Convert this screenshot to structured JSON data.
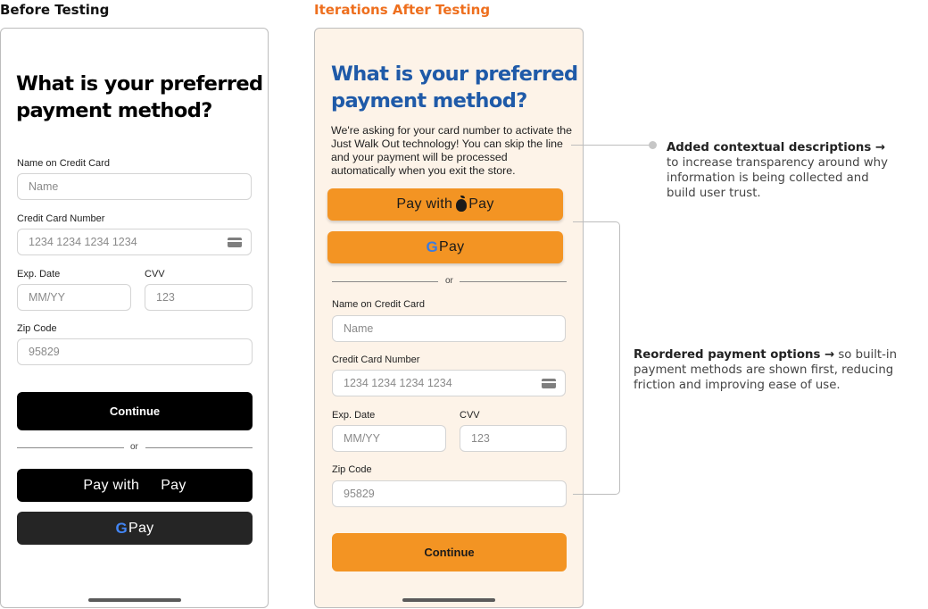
{
  "before": {
    "section_title": "Before Testing",
    "heading": "What is your preferred payment method?",
    "name_label": "Name on Credit Card",
    "name_placeholder": "Name",
    "card_label": "Credit Card Number",
    "card_placeholder": "1234 1234 1234 1234",
    "exp_label": "Exp. Date",
    "exp_placeholder": "MM/YY",
    "cvv_label": "CVV",
    "cvv_placeholder": "123",
    "zip_label": "Zip Code",
    "zip_placeholder": "95829",
    "continue_label": "Continue",
    "or_text": "or",
    "apple_pay_prefix": "Pay with",
    "apple_pay_suffix": "Pay",
    "google_pay_g": "G",
    "google_pay_label": "Pay"
  },
  "after": {
    "section_title": "Iterations After Testing",
    "heading": "What is your preferred payment method?",
    "description": "We're asking for your card number to activate the Just Walk Out technology! You can skip the line and your payment will be processed automatically when you exit the store.",
    "apple_pay_prefix": "Pay with",
    "apple_pay_suffix": "Pay",
    "google_pay_g": "G",
    "google_pay_label": "Pay",
    "or_text": "or",
    "name_label": "Name on Credit Card",
    "name_placeholder": "Name",
    "card_label": "Credit Card Number",
    "card_placeholder": "1234 1234 1234 1234",
    "exp_label": "Exp. Date",
    "exp_placeholder": "MM/YY",
    "cvv_label": "CVV",
    "cvv_placeholder": "123",
    "zip_label": "Zip Code",
    "zip_placeholder": "95829",
    "continue_label": "Continue"
  },
  "annotations": {
    "first_bold": "Added contextual descriptions →",
    "first_text": "to increase transparency around why information is being collected and build user trust.",
    "second_bold": "Reordered payment options →",
    "second_text": "so built-in payment methods are shown first, reducing friction and improving ease of use."
  },
  "colors": {
    "accent_orange": "#f39423",
    "heading_blue": "#1f5aa8",
    "after_bg": "#fdf3e8"
  }
}
